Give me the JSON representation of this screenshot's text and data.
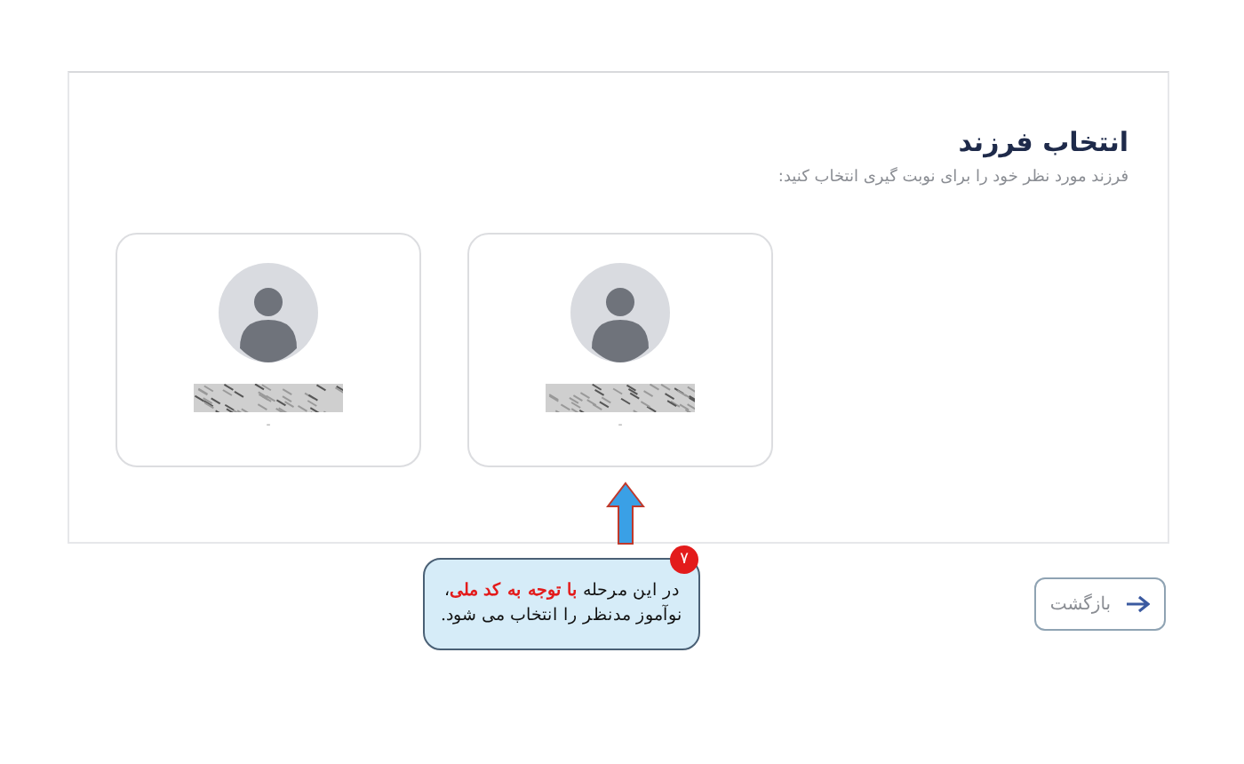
{
  "section": {
    "title": "انتخاب فرزند",
    "subtitle": "فرزند مورد نظر خود را برای نوبت گیری انتخاب کنید:"
  },
  "children": [
    {
      "caption": "-",
      "redacted": true
    },
    {
      "caption": "-",
      "redacted": true
    }
  ],
  "callout": {
    "badge": "۷",
    "text": "در این مرحله **با توجه به کد ملی**، نوآموز مدنظر را انتخاب می شود."
  },
  "back_button": {
    "label": "بازگشت"
  }
}
